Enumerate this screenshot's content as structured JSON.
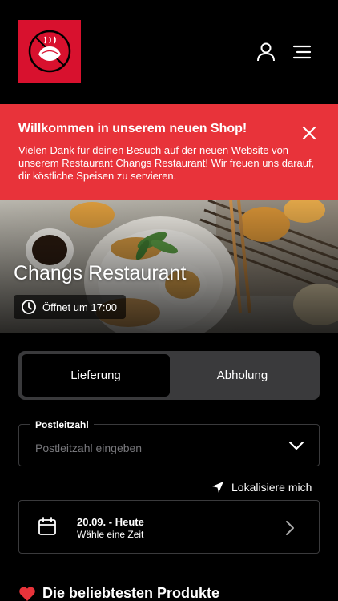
{
  "header": {
    "logo_icon": "dumpling-logo-icon",
    "user_icon": "user-icon",
    "menu_icon": "hamburger-menu-icon",
    "brand_color": "#d8112e"
  },
  "banner": {
    "title": "Willkommen in unserem neuen Shop!",
    "text": "Vielen Dank für deinen Besuch auf der neuen Website von unserem Restaurant Changs Restaurant! Wir freuen uns darauf, dir köstliche Speisen zu servieren.",
    "close_icon": "close-icon",
    "background": "#e8333a"
  },
  "hero": {
    "title": "Changs Restaurant",
    "opening": "Öffnet um 17:00",
    "clock_icon": "clock-icon"
  },
  "delivery_toggle": {
    "options": [
      "Lieferung",
      "Abholung"
    ],
    "selected": "Lieferung"
  },
  "postal": {
    "label": "Postleitzahl",
    "placeholder": "Postleitzahl eingeben",
    "value": ""
  },
  "locate": {
    "label": "Lokalisiere mich",
    "icon": "location-arrow-icon"
  },
  "time": {
    "date": "20.09. - Heute",
    "sub": "Wähle eine Zeit",
    "icon": "calendar-icon"
  },
  "popular": {
    "title": "Die beliebtesten Produkte",
    "icon": "heart-icon"
  }
}
